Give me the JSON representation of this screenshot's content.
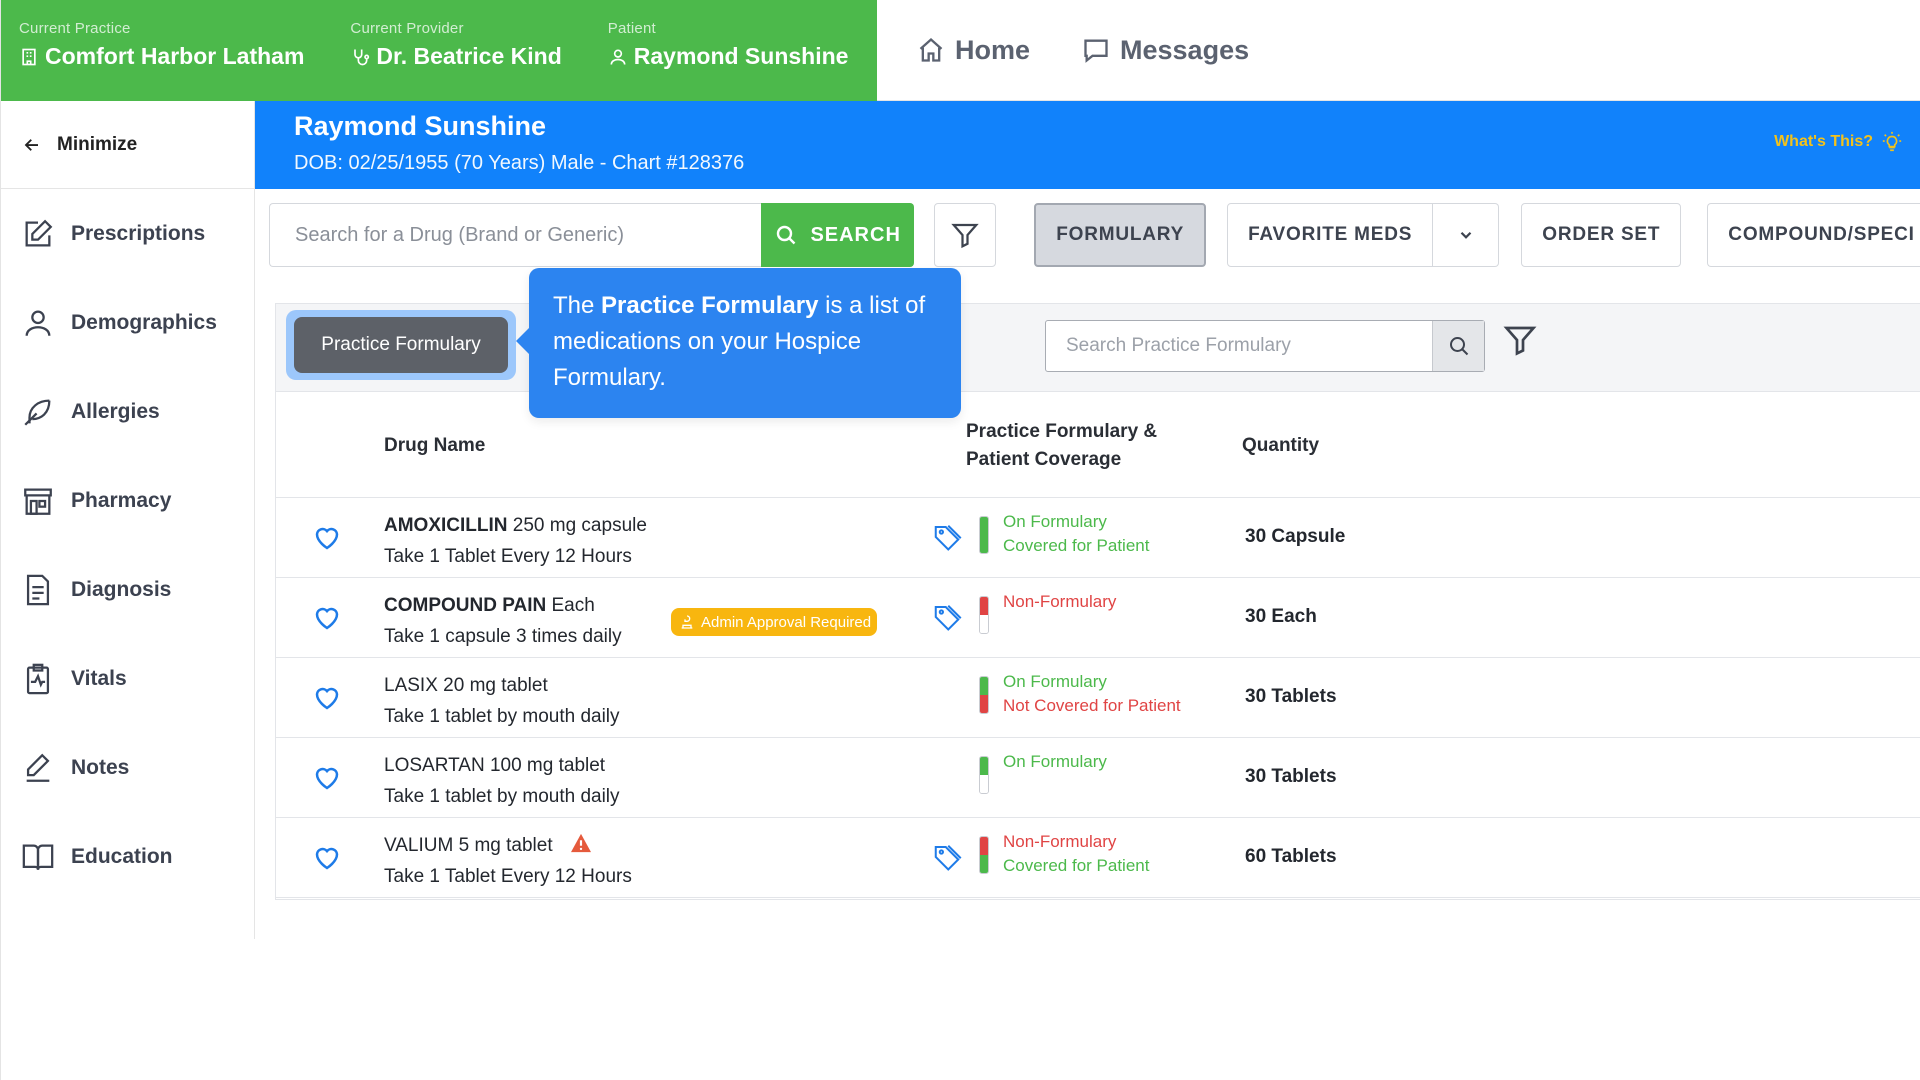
{
  "context": {
    "practice": {
      "label": "Current Practice",
      "value": "Comfort Harbor Latham"
    },
    "provider": {
      "label": "Current Provider",
      "value": "Dr. Beatrice Kind"
    },
    "patient": {
      "label": "Patient",
      "value": "Raymond Sunshine"
    }
  },
  "topnav": {
    "home": "Home",
    "messages": "Messages"
  },
  "sidebar": {
    "minimize": "Minimize",
    "items": [
      {
        "label": "Prescriptions",
        "icon": "edit-icon"
      },
      {
        "label": "Demographics",
        "icon": "user-icon"
      },
      {
        "label": "Allergies",
        "icon": "feather-icon"
      },
      {
        "label": "Pharmacy",
        "icon": "store-icon"
      },
      {
        "label": "Diagnosis",
        "icon": "document-icon"
      },
      {
        "label": "Vitals",
        "icon": "clipboard-pulse-icon"
      },
      {
        "label": "Notes",
        "icon": "pen-icon"
      },
      {
        "label": "Education",
        "icon": "book-icon"
      }
    ]
  },
  "banner": {
    "name": "Raymond Sunshine",
    "meta": "DOB: 02/25/1955 (70 Years) Male - Chart #128376",
    "whats_this": "What's This?"
  },
  "toolbar": {
    "search_placeholder": "Search for a Drug (Brand or Generic)",
    "search_button": "SEARCH",
    "formulary": "FORMULARY",
    "favorite_meds": "FAVORITE MEDS",
    "order_set": "ORDER SET",
    "compound": "COMPOUND/SPECI"
  },
  "formulary": {
    "chip": "Practice Formulary",
    "search_placeholder": "Search Practice Formulary",
    "columns": {
      "drug": "Drug Name",
      "coverage_line1": "Practice Formulary &",
      "coverage_line2": "Patient Coverage",
      "quantity": "Quantity"
    },
    "rows": [
      {
        "name": "AMOXICILLIN",
        "detail": " 250 mg capsule",
        "sig": "Take 1 Tablet Every 12 Hours",
        "status1": "On Formulary",
        "status2": "Covered for Patient",
        "quantity": "30 Capsule"
      },
      {
        "name": "COMPOUND PAIN",
        "detail": " Each",
        "sig": "Take 1 capsule 3 times daily",
        "badge": "Admin Approval Required",
        "status1": "Non-Formulary",
        "status2": "",
        "quantity": "30 Each"
      },
      {
        "name": "LASIX",
        "detail": " 20 mg tablet",
        "sig": "Take 1 tablet by mouth daily",
        "status1": "On Formulary",
        "status2": "Not Covered for Patient",
        "quantity": "30 Tablets"
      },
      {
        "name": "LOSARTAN",
        "detail": " 100 mg tablet",
        "sig": "Take 1 tablet by mouth daily",
        "status1": "On Formulary",
        "status2": "",
        "quantity": "30 Tablets"
      },
      {
        "name": "VALIUM",
        "detail": " 5 mg tablet",
        "sig": "Take 1 Tablet Every 12 Hours",
        "status1": "Non-Formulary",
        "status2": "Covered for Patient",
        "quantity": "60 Tablets"
      }
    ]
  },
  "tooltip": {
    "pre": "The ",
    "bold": "Practice Formulary",
    "post": " is a list of medications on your Hospice Formulary."
  },
  "colors": {
    "brand_green": "#4cb94b",
    "banner_blue": "#1182fb",
    "tooltip_blue": "#2c84f0",
    "warning": "#f8b60f",
    "danger": "#e04444"
  }
}
